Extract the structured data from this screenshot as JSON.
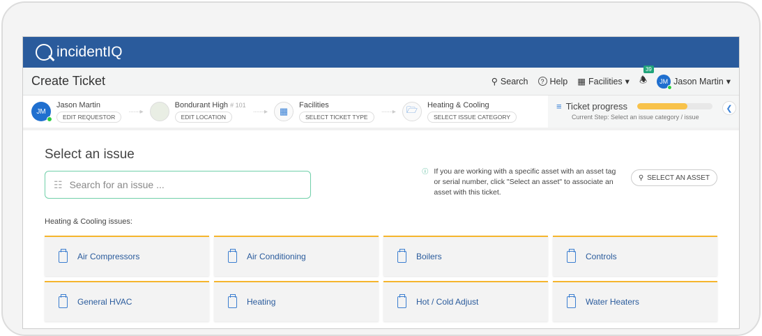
{
  "brand": "incidentIQ",
  "page_title": "Create Ticket",
  "nav": {
    "search": "Search",
    "help": "Help",
    "facilities": "Facilities",
    "notifications": "39",
    "user_initials": "JM",
    "user_name": "Jason Martin"
  },
  "steps": [
    {
      "title": "Jason Martin",
      "extra": "",
      "button": "EDIT REQUESTOR"
    },
    {
      "title": "Bondurant High",
      "extra": "# 101",
      "button": "EDIT LOCATION"
    },
    {
      "title": "Facilities",
      "extra": "",
      "button": "SELECT TICKET TYPE"
    },
    {
      "title": "Heating & Cooling",
      "extra": "",
      "button": "SELECT ISSUE CATEGORY"
    }
  ],
  "progress": {
    "title": "Ticket progress",
    "percent": 67,
    "current_step": "Current Step:  Select an issue category / issue"
  },
  "main": {
    "heading": "Select an issue",
    "search_placeholder": "Search for an issue ...",
    "info": "If you are working with a specific asset with an asset tag or serial number, click \"Select an asset\" to associate an asset with this ticket.",
    "asset_button": "SELECT AN ASSET",
    "category_label": "Heating & Cooling issues:",
    "issues": [
      "Air Compressors",
      "Air Conditioning",
      "Boilers",
      "Controls",
      "General HVAC",
      "Heating",
      "Hot / Cold Adjust",
      "Water Heaters"
    ]
  }
}
